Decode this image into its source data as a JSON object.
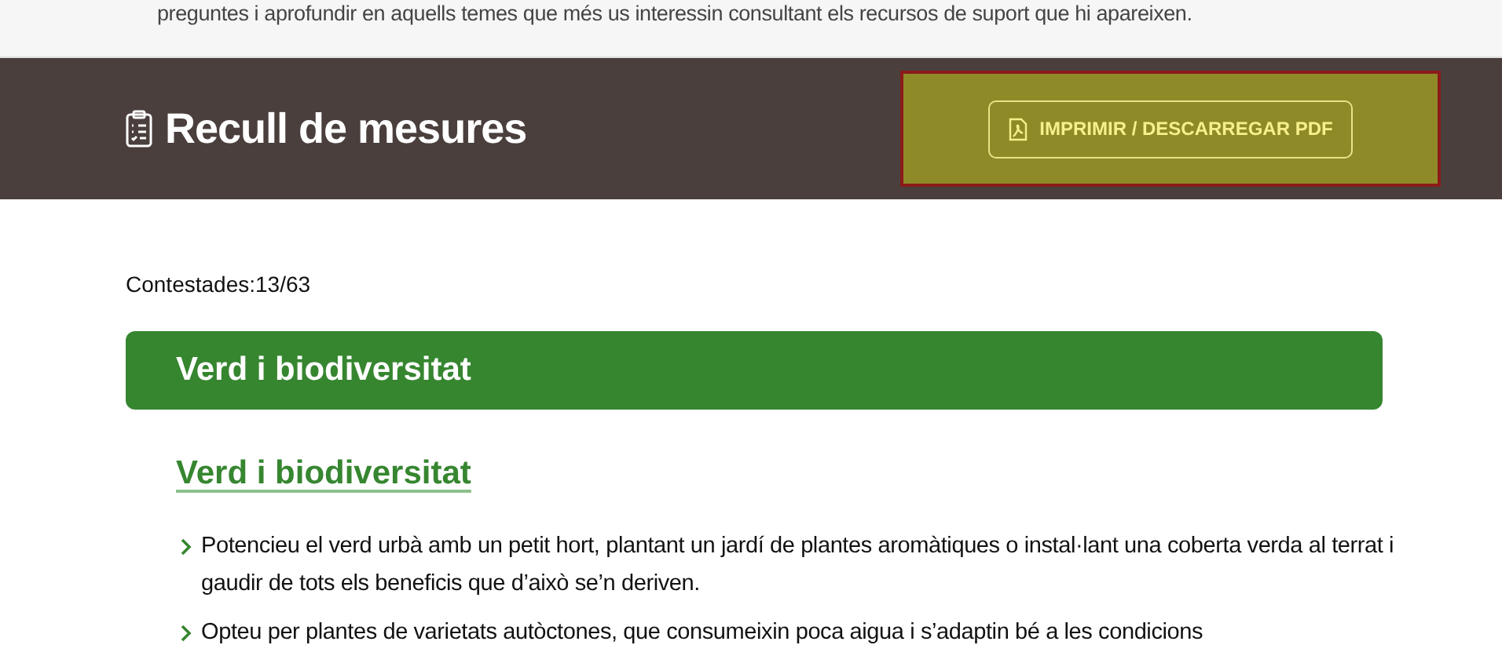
{
  "intro": {
    "text": "preguntes i aprofundir en aquells temes que més us interessin consultant els recursos de suport que hi apareixen."
  },
  "header": {
    "title": "Recull de mesures",
    "button": "IMPRIMIR / DESCARREGAR PDF"
  },
  "progress": {
    "text": "Contestades:13/63"
  },
  "section": {
    "title": "Verd i biodiversitat",
    "link": "Verd i biodiversitat",
    "items": [
      {
        "text": "Potencieu el verd urbà amb un petit hort, plantant un jardí de plantes aromàtiques o instal·lant una coberta verda al terrat i gaudir de tots els beneficis que d’això se’n deriven."
      },
      {
        "text": "Opteu per plantes de varietats autòctones, que consumeixin poca aigua i s’adaptin bé a les condicions"
      }
    ]
  }
}
